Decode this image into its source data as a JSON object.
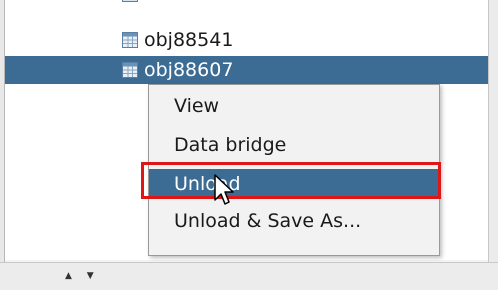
{
  "tree": {
    "items": [
      {
        "label": "obj88541",
        "selected": false,
        "icon": "table-icon"
      },
      {
        "label": "obj88607",
        "selected": true,
        "icon": "table-icon"
      }
    ]
  },
  "context_menu": {
    "items": [
      {
        "label": "View",
        "highlighted": false
      },
      {
        "label": "Data bridge",
        "highlighted": false
      },
      {
        "label": "Unload",
        "highlighted": true
      },
      {
        "label": "Unload & Save As...",
        "highlighted": false
      }
    ]
  },
  "annotation": {
    "color": "#e01616",
    "target": "Unload"
  },
  "colors": {
    "selection": "#3c6b93",
    "menu_background": "#f2f2f2",
    "panel_background": "#ffffff"
  },
  "status_bar": {
    "scroll_arrows": "▲ ▼"
  }
}
